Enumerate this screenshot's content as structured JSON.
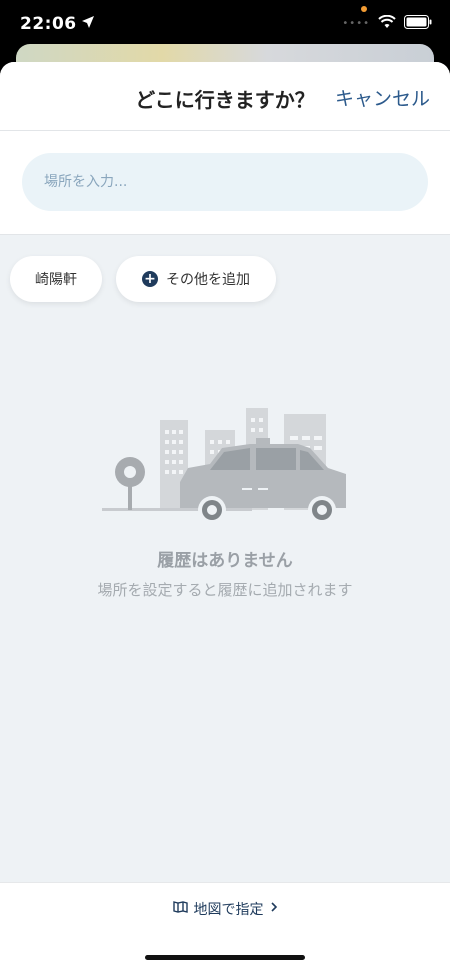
{
  "status": {
    "time": "22:06"
  },
  "header": {
    "title": "どこに行きますか？",
    "cancel": "キャンセル"
  },
  "search": {
    "placeholder": "場所を入力..."
  },
  "chips": [
    {
      "label": "崎陽軒"
    },
    {
      "label": "その他を追加"
    }
  ],
  "empty": {
    "title": "履歴はありません",
    "subtitle": "場所を設定すると履歴に追加されます"
  },
  "footer": {
    "map_link": "地図で指定"
  },
  "colors": {
    "accent": "#2c5a8c",
    "navy": "#1f3b5c",
    "background": "#eef2f5"
  }
}
